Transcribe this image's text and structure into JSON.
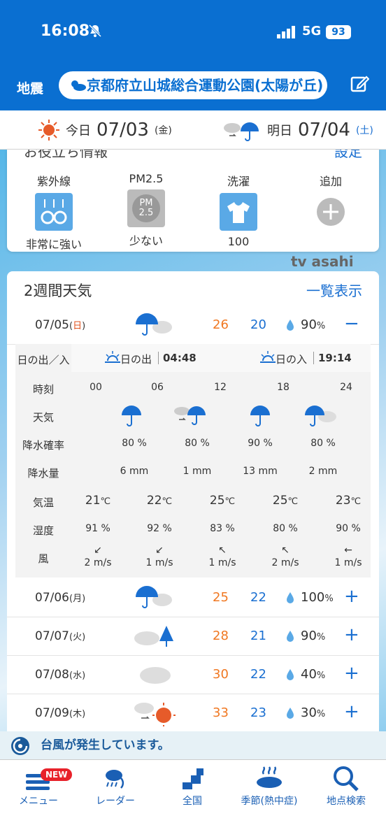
{
  "status": {
    "time": "16:08",
    "network": "5G",
    "battery": "93"
  },
  "topbar": {
    "quake": "地震",
    "location": "京都府立山城総合運動公園(太陽が丘)"
  },
  "datebar": {
    "today_label": "今日",
    "today_date": "07/03",
    "today_wd": "(金)",
    "tomorrow_label": "明日",
    "tomorrow_date": "07/04",
    "tomorrow_wd": "(土)"
  },
  "indices": {
    "header_left": "お役立ち情報",
    "header_right": "設定",
    "items": [
      {
        "title": "紫外線",
        "value": "非常に強い"
      },
      {
        "title": "PM2.5",
        "value": "少ない",
        "badge": "PM 2.5"
      },
      {
        "title": "洗濯",
        "value": "100"
      },
      {
        "title": "追加",
        "value": ""
      }
    ]
  },
  "brand": "tv asahi",
  "two_week": {
    "title": "2週間天気",
    "all_label": "一覧表示"
  },
  "days": [
    {
      "date": "07/05",
      "wd": "日",
      "weather": "rain-cloud",
      "hi": "26",
      "lo": "20",
      "pop": "90",
      "unit": "%",
      "toggle": "−"
    },
    {
      "date": "07/06",
      "wd": "月",
      "weather": "rain-cloud",
      "hi": "25",
      "lo": "22",
      "pop": "100",
      "unit": "%",
      "toggle": "+"
    },
    {
      "date": "07/07",
      "wd": "火",
      "weather": "cloud-rain",
      "hi": "28",
      "lo": "21",
      "pop": "90",
      "unit": "%",
      "toggle": "+"
    },
    {
      "date": "07/08",
      "wd": "水",
      "weather": "cloud",
      "hi": "30",
      "lo": "22",
      "pop": "40",
      "unit": "%",
      "toggle": "+"
    },
    {
      "date": "07/09",
      "wd": "木",
      "weather": "cloud-sun",
      "hi": "33",
      "lo": "23",
      "pop": "30",
      "unit": "%",
      "toggle": "+"
    }
  ],
  "detail": {
    "sun_label": "日の出／入",
    "sunrise_label": "日の出",
    "sunrise": "04:48",
    "sunset_label": "日の入",
    "sunset": "19:14",
    "labels": {
      "time": "時刻",
      "weather": "天気",
      "pop": "降水確率",
      "amount": "降水量",
      "temp": "気温",
      "humid": "湿度",
      "wind": "風"
    },
    "hours": [
      "00",
      "06",
      "12",
      "18",
      "24"
    ],
    "periods": [
      {
        "weather": "umbrella",
        "pop": "80",
        "amount": "6"
      },
      {
        "weather": "cloud-to-umbrella",
        "pop": "80",
        "amount": "1"
      },
      {
        "weather": "umbrella",
        "pop": "90",
        "amount": "13"
      },
      {
        "weather": "umbrella-cloud",
        "pop": "80",
        "amount": "2"
      }
    ],
    "pct_unit": "%",
    "mm_unit": "mm",
    "temp_unit": "℃",
    "wind_unit": "m/s",
    "temps": [
      "21",
      "22",
      "25",
      "25",
      "23"
    ],
    "humid": [
      "91",
      "92",
      "83",
      "80",
      "90"
    ],
    "winds": [
      "2",
      "1",
      "1",
      "2",
      "1"
    ]
  },
  "typhoon": "台風が発生しています。",
  "tabs": [
    {
      "label": "メニュー",
      "badge": "NEW"
    },
    {
      "label": "レーダー"
    },
    {
      "label": "全国"
    },
    {
      "label": "季節(熱中症)"
    },
    {
      "label": "地点検索"
    }
  ],
  "colors": {
    "brand_blue": "#0a6fd1",
    "high_temp": "#f07822",
    "low_temp": "#1a6fd1"
  }
}
